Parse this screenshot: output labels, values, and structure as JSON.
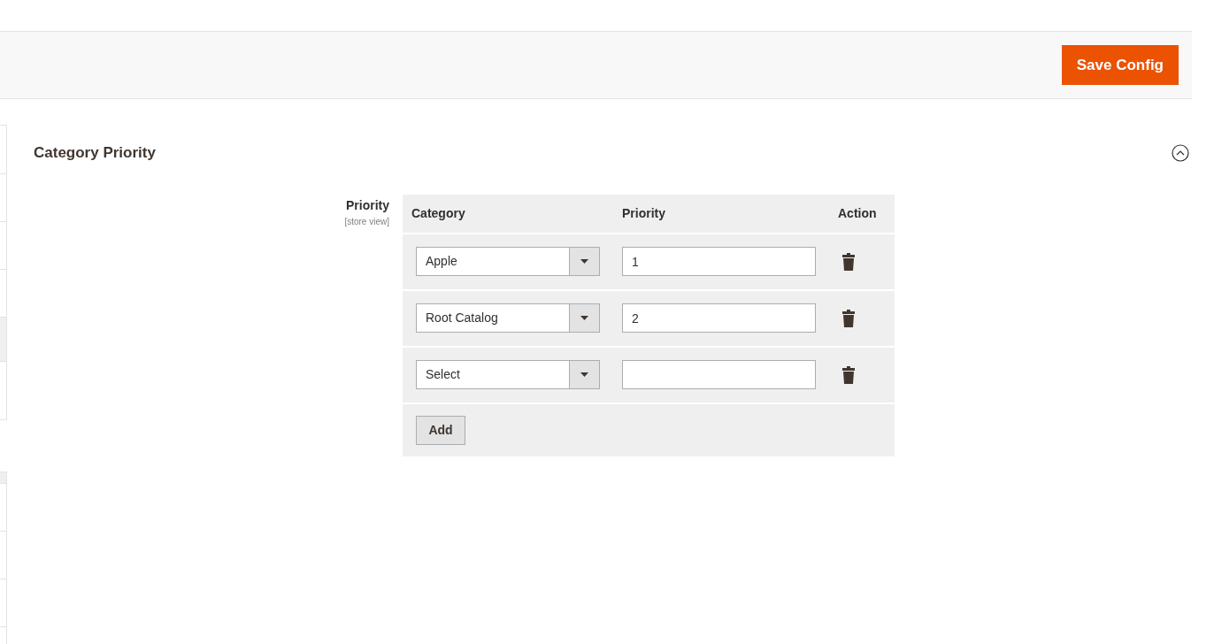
{
  "page_actions": {
    "save_button": "Save Config"
  },
  "section": {
    "title": "Category Priority",
    "expanded": true,
    "field": {
      "label": "Priority",
      "scope": "[store view]",
      "table": {
        "columns": [
          "Category",
          "Priority",
          "Action"
        ],
        "rows": [
          {
            "category": "Apple",
            "priority": "1"
          },
          {
            "category": "Root Catalog",
            "priority": "2"
          },
          {
            "category": "Select",
            "priority": ""
          }
        ],
        "add_button": "Add"
      }
    }
  }
}
